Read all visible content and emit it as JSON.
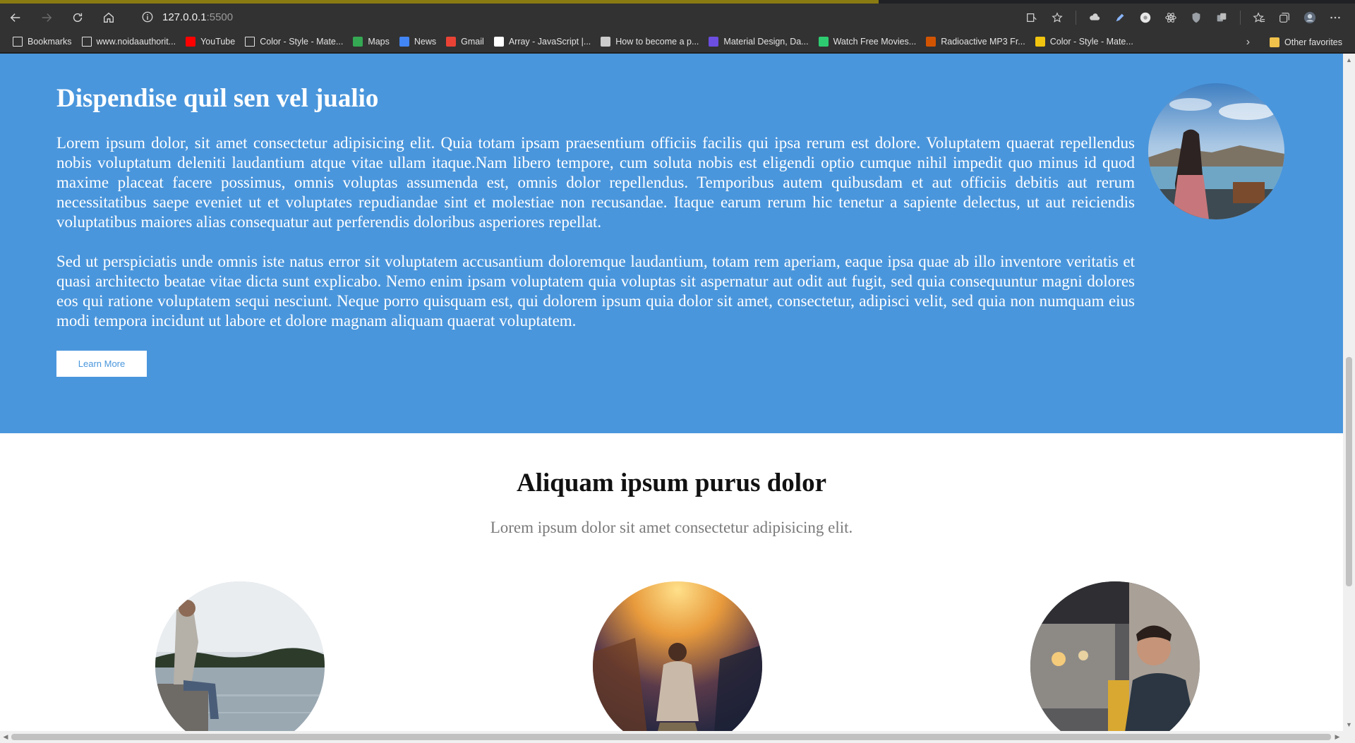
{
  "browser": {
    "url_host": "127.0.0.1",
    "url_port": ":5500",
    "icons": [
      "back-icon",
      "forward-icon",
      "reload-icon",
      "home-icon",
      "info-icon",
      "immersive-reader-icon",
      "add-favorite-icon",
      "extension-cloud-icon",
      "extension-pen-icon",
      "extension-circle-icon",
      "react-devtools-icon",
      "shield-icon",
      "extension-copy-icon",
      "favorites-icon",
      "collections-icon",
      "profile-avatar-icon",
      "more-icon"
    ]
  },
  "bookmarks": {
    "items": [
      {
        "label": "Bookmarks",
        "icon": "bookmarks-icon",
        "color": "#e3e3e3"
      },
      {
        "label": "www.noidaauthorit...",
        "icon": "page-icon",
        "color": "#e3e3e3"
      },
      {
        "label": "YouTube",
        "icon": "youtube-icon",
        "color": "#ff0000"
      },
      {
        "label": "Color - Style - Mate...",
        "icon": "page-icon",
        "color": "#e3e3e3"
      },
      {
        "label": "Maps",
        "icon": "maps-icon",
        "color": "#34a853"
      },
      {
        "label": "News",
        "icon": "news-icon",
        "color": "#4285f4"
      },
      {
        "label": "Gmail",
        "icon": "gmail-icon",
        "color": "#ea4335"
      },
      {
        "label": "Array - JavaScript |...",
        "icon": "mdn-icon",
        "color": "#ffffff"
      },
      {
        "label": "How to become a p...",
        "icon": "lambda-icon",
        "color": "#cccccc"
      },
      {
        "label": "Material Design, Da...",
        "icon": "vp-icon",
        "color": "#6c4ee0"
      },
      {
        "label": "Watch Free Movies...",
        "icon": "play-circle-icon",
        "color": "#2ecc71"
      },
      {
        "label": "Radioactive MP3 Fr...",
        "icon": "paw-icon",
        "color": "#d35400"
      },
      {
        "label": "Color - Style - Mate...",
        "icon": "folder-color-icon",
        "color": "#f1c40f"
      }
    ],
    "other_favorites": "Other favorites"
  },
  "hero": {
    "title": "Dispendise quil sen vel jualio",
    "paragraph1": "Lorem ipsum dolor, sit amet consectetur adipisicing elit. Quia totam ipsam praesentium officiis facilis qui ipsa rerum est dolore. Voluptatem quaerat repellendus nobis voluptatum deleniti laudantium atque vitae ullam itaque.Nam libero tempore, cum soluta nobis est eligendi optio cumque nihil impedit quo minus id quod maxime placeat facere possimus, omnis voluptas assumenda est, omnis dolor repellendus. Temporibus autem quibusdam et aut officiis debitis aut rerum necessitatibus saepe eveniet ut et voluptates repudiandae sint et molestiae non recusandae. Itaque earum rerum hic tenetur a sapiente delectus, ut aut reiciendis voluptatibus maiores alias consequatur aut perferendis doloribus asperiores repellat.",
    "paragraph2": "Sed ut perspiciatis unde omnis iste natus error sit voluptatem accusantium doloremque laudantium, totam rem aperiam, eaque ipsa quae ab illo inventore veritatis et quasi architecto beatae vitae dicta sunt explicabo. Nemo enim ipsam voluptatem quia voluptas sit aspernatur aut odit aut fugit, sed quia consequuntur magni dolores eos qui ratione voluptatem sequi nesciunt. Neque porro quisquam est, qui dolorem ipsum quia dolor sit amet, consectetur, adipisci velit, sed quia non numquam eius modi tempora incidunt ut labore et dolore magnam aliquam quaerat voluptatem.",
    "button_label": "Learn More",
    "background_color": "#4a96dc"
  },
  "section2": {
    "title": "Aliquam ipsum purus dolor",
    "subtitle": "Lorem ipsum dolor sit amet consectetur adipisicing elit."
  }
}
